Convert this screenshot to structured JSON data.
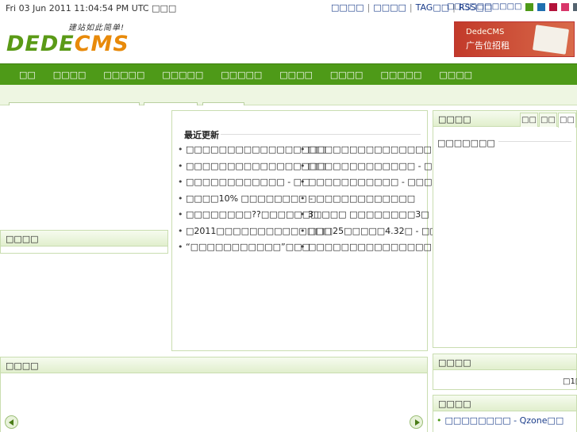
{
  "topbar": {
    "date": "Fri 03 Jun 2011 11:04:54 PM UTC",
    "date_suffix": "□□□",
    "links": [
      "□□□□",
      "□□□□",
      "TAG□□",
      "RSS□□"
    ],
    "skin_label": "□□□□□□□□□□",
    "skin_colors": [
      "#4e9a18",
      "#1f6fb0",
      "#b3123a",
      "#d8366a",
      "#556470",
      "#8b5a3c"
    ]
  },
  "logo": {
    "slogan": "建站如此简单!",
    "mark_a": "DEDE",
    "mark_b": "CMS"
  },
  "ad": {
    "line1": "DedeCMS",
    "line2": "广告位招租"
  },
  "nav": {
    "items": [
      "□□",
      "□□□□",
      "□□□□□",
      "□□□□□",
      "□□□□□",
      "□□□□",
      "□□□□",
      "□□□□□",
      "□□□□"
    ]
  },
  "left_panel": {
    "title": "□□□□"
  },
  "bottom_panel": {
    "title": "□□□□"
  },
  "recent": {
    "title": "最近更新",
    "col1": [
      "□□□□□□□□□□□□□□□□□",
      "□□□□□□□□□□□□□□□□□",
      "□□□□□□□□□□□□ - □□",
      "□□□□10% □□□□□□□□ -",
      "□□□□□□□□??□□□□□□□",
      "□2011□□□□□□□□□□□□□□",
      "“□□□□□□□□□□□”□□□"
    ],
    "col2": [
      "□□□□□□□□□□□□□□□",
      "□□□□□□□□□□□□□ - □",
      "□□□□□□□□□□□ - □□□",
      "□□□□□□□□□□□□□",
      "3□□□□ □□□□□□□□3□",
      "□□□25□□□□□4.32□ - □□",
      "□□□□□□□□□□□□□□□"
    ]
  },
  "right_main": {
    "title": "□□□□",
    "tabs": [
      "□□",
      "□□",
      "□□"
    ],
    "text": "□□□□□□□"
  },
  "right_mid": {
    "title": "□□□□",
    "pager": "□1□"
  },
  "right_bottom": {
    "title": "□□□□",
    "item": "□□□□□□□□ - Qzone□□"
  }
}
